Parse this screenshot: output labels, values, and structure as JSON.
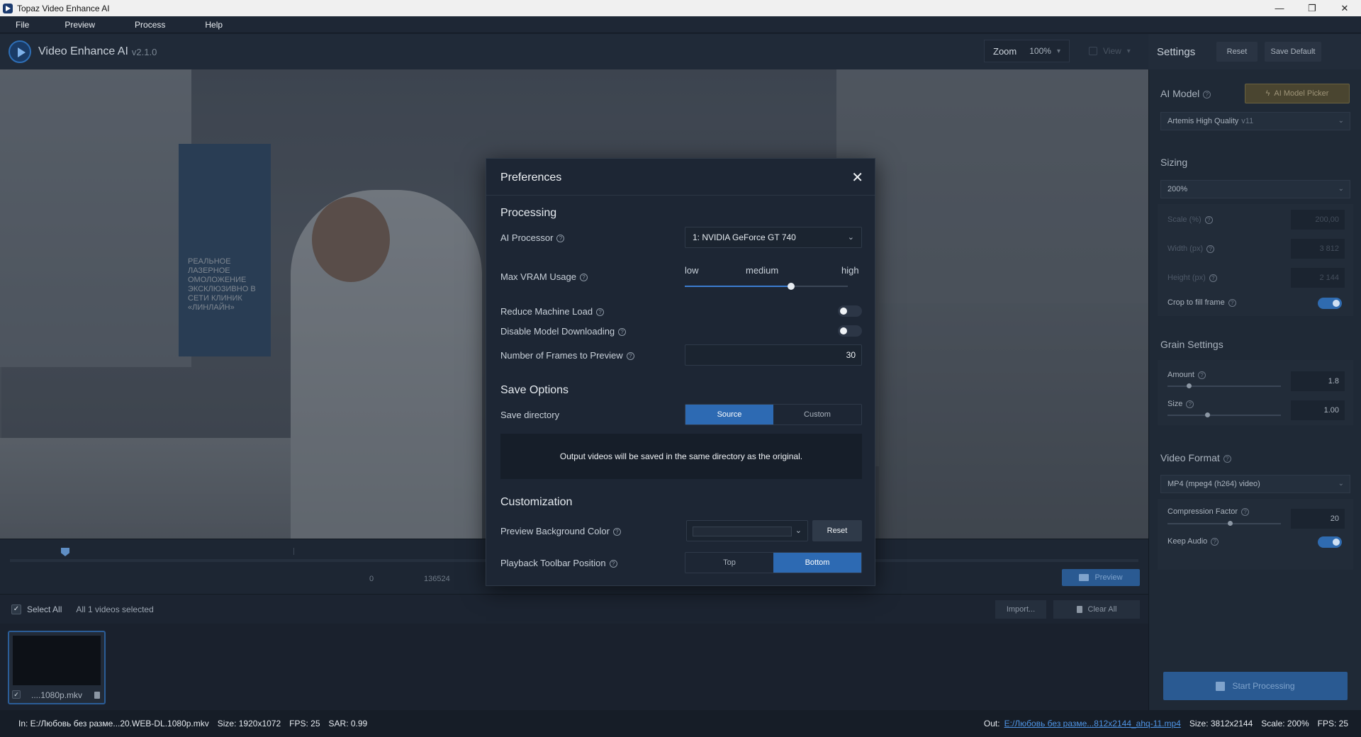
{
  "window": {
    "title": "Topaz Video Enhance AI",
    "controls": [
      "—",
      "❐",
      "✕"
    ]
  },
  "menu": {
    "items": [
      "File",
      "Preview",
      "Process",
      "Help"
    ]
  },
  "header": {
    "app_name": "Video Enhance AI",
    "version": "v2.1.0",
    "zoom_label": "Zoom",
    "zoom_value": "100%",
    "view_label": "View"
  },
  "video": {
    "poster_text": "РЕАЛЬНОЕ ЛАЗЕРНОЕ ОМОЛОЖЕНИЕ ЭКСКЛЮЗИВНО В СЕТИ КЛИНИК «ЛИНЛАЙН»"
  },
  "timeline": {
    "start_label": "0",
    "end_label": "136524",
    "preview_label": "Preview"
  },
  "selection": {
    "select_all_label": "Select All",
    "count_text": "All 1 videos selected",
    "import_label": "Import...",
    "clear_label": "Clear All"
  },
  "thumbnail": {
    "name": "....1080p.mkv"
  },
  "settings": {
    "title": "Settings",
    "reset_label": "Reset",
    "save_default_label": "Save Default",
    "ai_model_title": "AI Model",
    "model_picker_label": "AI Model Picker",
    "model_name": "Artemis High Quality",
    "model_version": "v11",
    "sizing_title": "Sizing",
    "sizing_value": "200%",
    "scale_label": "Scale (%)",
    "scale_value": "200,00",
    "width_label": "Width (px)",
    "width_value": "3 812",
    "height_label": "Height (px)",
    "height_value": "2 144",
    "crop_label": "Crop to fill frame",
    "crop_on": true,
    "grain_title": "Grain Settings",
    "amount_label": "Amount",
    "amount_value": "1.8",
    "amount_level": 0.19,
    "size_label": "Size",
    "size_value": "1.00",
    "size_level": 0.35,
    "format_title": "Video Format",
    "format_value": "MP4 (mpeg4 (h264) video)",
    "compression_label": "Compression Factor",
    "compression_value": "20",
    "compression_level": 0.55,
    "audio_label": "Keep Audio",
    "audio_on": true,
    "start_label": "Start Processing"
  },
  "status": {
    "in_text": "In: E:/Любовь без разме...20.WEB-DL.1080p.mkv",
    "in_size": "Size: 1920x1072",
    "in_fps": "FPS: 25",
    "in_sar": "SAR: 0.99",
    "out_label": "Out:",
    "out_path": "E:/Любовь без разме...812x2144_ahq-11.mp4",
    "out_size": "Size: 3812x2144",
    "out_scale": "Scale: 200%",
    "out_fps": "FPS: 25"
  },
  "preferences": {
    "title": "Preferences",
    "processing_title": "Processing",
    "ai_processor_label": "AI Processor",
    "ai_processor_value": "1: NVIDIA GeForce GT 740",
    "vram_label": "Max VRAM Usage",
    "vram_low": "low",
    "vram_medium": "medium",
    "vram_high": "high",
    "vram_level": 0.65,
    "reduce_load_label": "Reduce Machine Load",
    "reduce_load_on": false,
    "disable_download_label": "Disable Model Downloading",
    "disable_download_on": false,
    "frames_label": "Number of Frames to Preview",
    "frames_value": "30",
    "save_title": "Save Options",
    "save_dir_label": "Save directory",
    "save_source": "Source",
    "save_custom": "Custom",
    "save_selected": "Source",
    "save_info": "Output videos will be saved in the same directory as the original.",
    "custom_title": "Customization",
    "bg_color_label": "Preview Background Color",
    "bg_reset_label": "Reset",
    "toolbar_pos_label": "Playback Toolbar Position",
    "toolbar_top": "Top",
    "toolbar_bottom": "Bottom",
    "toolbar_selected": "Bottom"
  }
}
